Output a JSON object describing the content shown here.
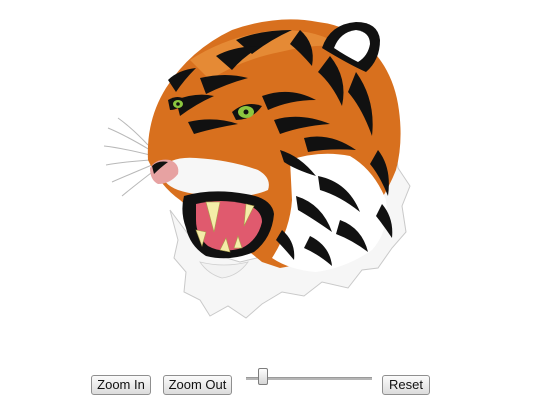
{
  "toolbar": {
    "zoom_in_label": "Zoom In",
    "zoom_out_label": "Zoom Out",
    "reset_label": "Reset"
  },
  "zoom_slider": {
    "value": 0.12
  },
  "image": {
    "subject": "tiger-head-illustration"
  },
  "colors": {
    "fur_orange": "#d8701e",
    "fur_dark_orange": "#b9561a",
    "stripe": "#111111",
    "eye": "#8cc63f",
    "mouth": "#e05a6e",
    "tooth": "#f4eda8"
  }
}
